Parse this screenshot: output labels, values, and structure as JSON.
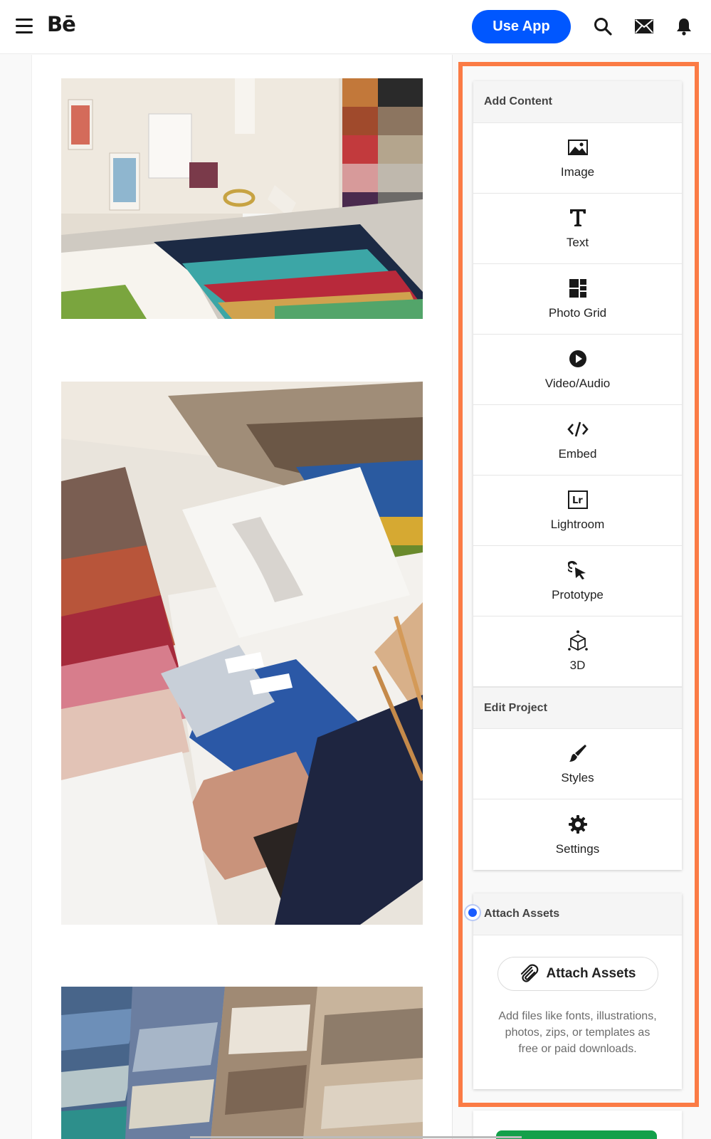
{
  "header": {
    "logo": "Bē",
    "use_app_label": "Use App",
    "icons": [
      "menu-icon",
      "search-icon",
      "mail-icon",
      "bell-icon"
    ]
  },
  "canvas": {
    "images": [
      {
        "alt": "fashion studio moodboard with fabric swatches"
      },
      {
        "alt": "hand holding fabric swatches with sketches"
      },
      {
        "alt": "stacked fabric swatch books"
      }
    ]
  },
  "panel": {
    "add_content_title": "Add Content",
    "tools": [
      {
        "label": "Image",
        "icon": "image-icon"
      },
      {
        "label": "Text",
        "icon": "text-icon"
      },
      {
        "label": "Photo Grid",
        "icon": "photo-grid-icon"
      },
      {
        "label": "Video/Audio",
        "icon": "play-icon"
      },
      {
        "label": "Embed",
        "icon": "embed-code-icon"
      },
      {
        "label": "Lightroom",
        "icon": "lightroom-icon"
      },
      {
        "label": "Prototype",
        "icon": "prototype-cursor-icon"
      },
      {
        "label": "3D",
        "icon": "cube-3d-icon"
      }
    ],
    "edit_project_title": "Edit Project",
    "edit_tools": [
      {
        "label": "Styles",
        "icon": "brush-icon"
      },
      {
        "label": "Settings",
        "icon": "gear-icon"
      }
    ],
    "attach": {
      "title": "Attach Assets",
      "button_label": "Attach Assets",
      "description": "Add files like fonts, illustrations, photos, zips, or templates as free or paid downloads."
    }
  },
  "colors": {
    "accent": "#0057ff",
    "highlight": "#fb7b45",
    "radio": "#1a5cff"
  }
}
